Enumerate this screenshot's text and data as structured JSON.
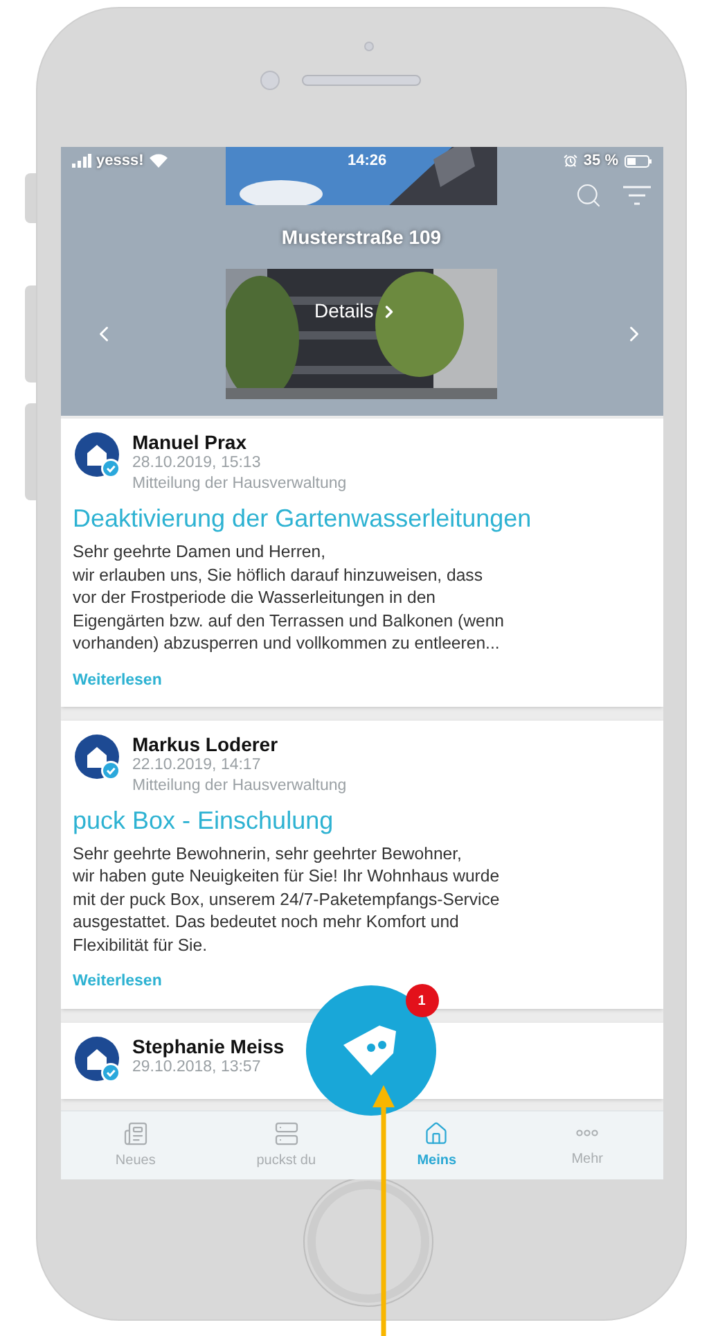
{
  "status_bar": {
    "carrier": "yesss!",
    "time": "14:26",
    "battery": "35 %"
  },
  "header": {
    "title": "Musterstraße 109",
    "details": "Details"
  },
  "posts": [
    {
      "author": "Manuel Prax",
      "date": "28.10.2019, 15:13",
      "category": "Mitteilung der Hausverwaltung",
      "title": "Deaktivierung der Gartenwasserleitungen",
      "lines": [
        "Sehr geehrte Damen und Herren,",
        "wir erlauben uns, Sie höflich darauf hinzuweisen, dass",
        "vor der Frostperiode die Wasserleitungen in den",
        "Eigengärten bzw. auf den Terrassen und Balkonen (wenn",
        "vorhanden) abzusperren und vollkommen zu entleeren..."
      ],
      "link": "Weiterlesen"
    },
    {
      "author": "Markus Loderer",
      "date": "22.10.2019, 14:17",
      "category": "Mitteilung der Hausverwaltung",
      "title": "puck Box - Einschulung",
      "lines": [
        "Sehr geehrte Bewohnerin, sehr geehrter Bewohner,",
        "wir haben gute Neuigkeiten für Sie! Ihr Wohnhaus wurde",
        "mit der puck Box, unserem 24/7-Paketempfangs-Service",
        "ausgestattet. Das bedeutet noch mehr Komfort und",
        "Flexibilität für Sie."
      ],
      "link": "Weiterlesen"
    },
    {
      "author": "Stephanie Meiss",
      "date": "29.10.2018, 13:57"
    }
  ],
  "fab": {
    "badge": "1"
  },
  "tabs": [
    {
      "kind": "news",
      "label": "Neues",
      "selected": false
    },
    {
      "kind": "list",
      "label": "puckst du",
      "selected": false
    },
    {
      "kind": "home",
      "label": "Meins",
      "selected": true
    },
    {
      "kind": "more",
      "label": "Mehr",
      "selected": false
    }
  ]
}
